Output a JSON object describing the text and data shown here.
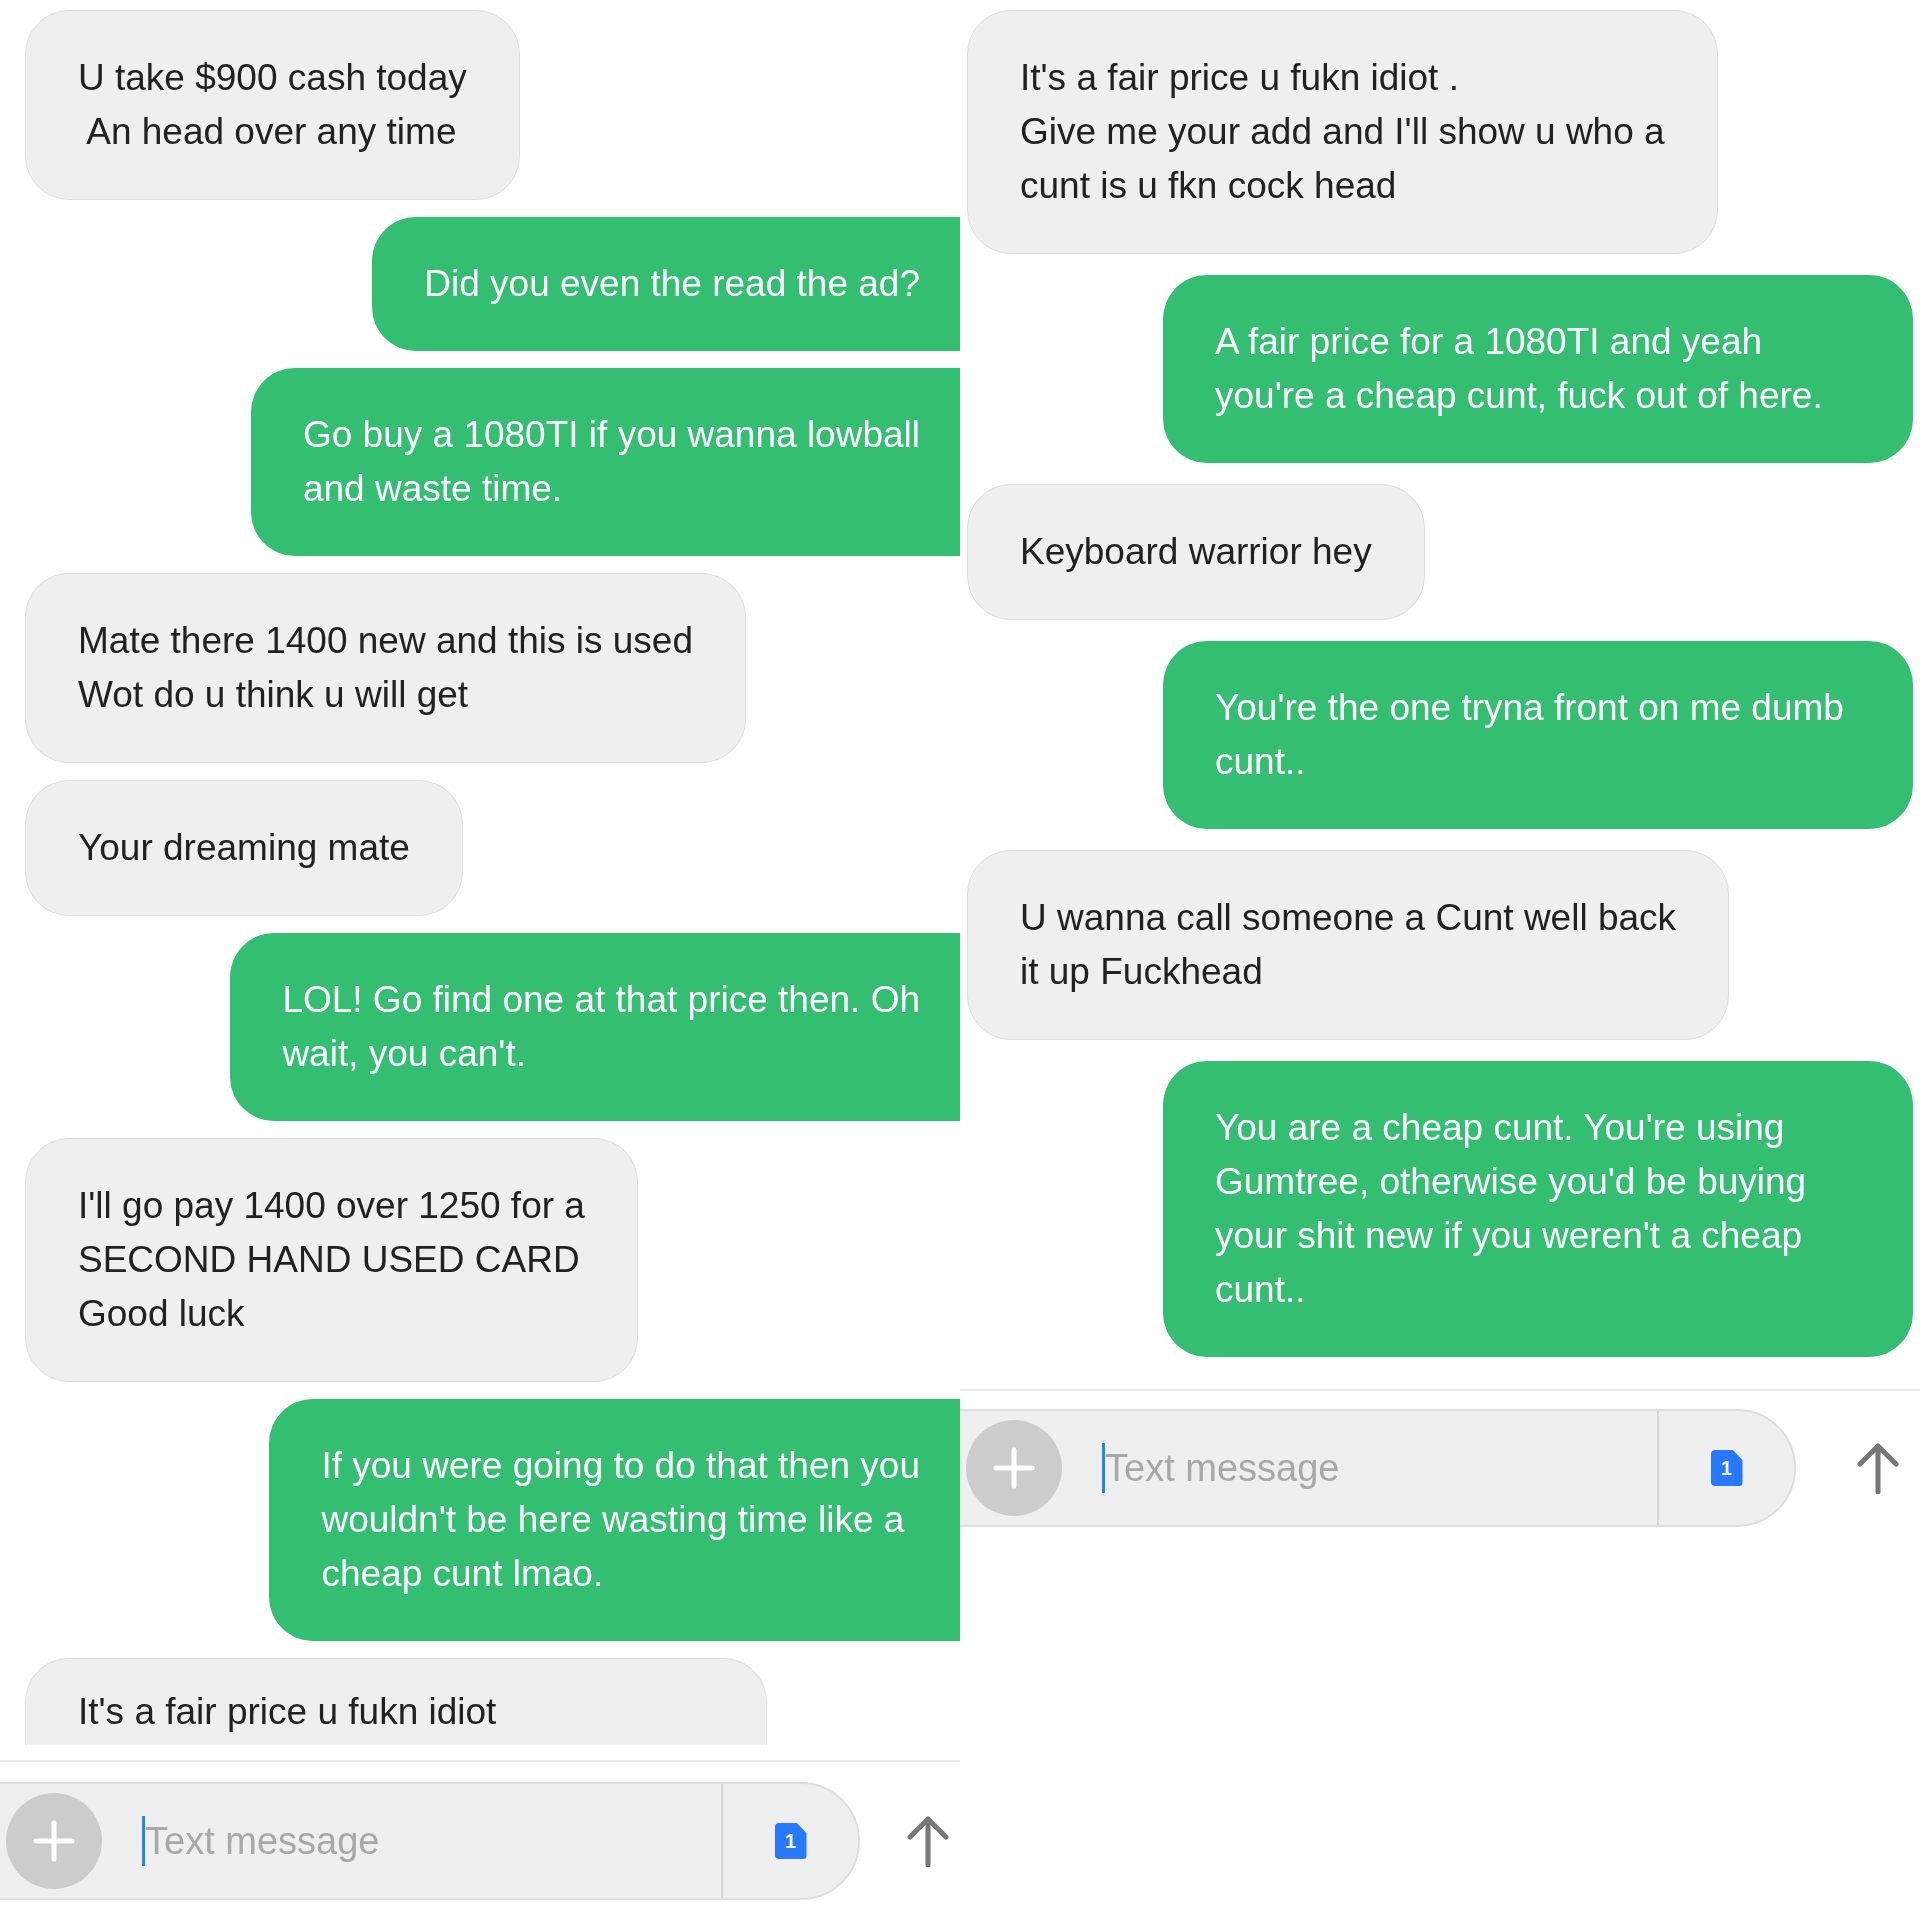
{
  "panels": [
    {
      "messages": [
        {
          "kind": "received",
          "text": "U take $900 cash today\n An head over any time",
          "clipped": false
        },
        {
          "kind": "sent",
          "text": "Did you even the read the ad?",
          "clipped": false
        },
        {
          "kind": "sent",
          "text": "Go buy a 1080TI if you wanna lowball\nand waste time.",
          "clipped": false
        },
        {
          "kind": "received",
          "text": "Mate there 1400 new and this is used\nWot do u think u will get",
          "clipped": false
        },
        {
          "kind": "received",
          "text": "Your dreaming mate",
          "clipped": false
        },
        {
          "kind": "sent",
          "text": "LOL! Go find one at that price then. Oh\nwait, you can't.",
          "clipped": false
        },
        {
          "kind": "received",
          "text": "I'll go pay 1400 over 1250 for a\nSECOND HAND USED CARD\nGood luck",
          "clipped": false
        },
        {
          "kind": "sent",
          "text": "If you were going to do that then you\nwouldn't be here wasting time like a\ncheap cunt lmao.",
          "clipped": false
        },
        {
          "kind": "received",
          "text": "It's a fair price u fukn idiot",
          "clipped": true
        }
      ],
      "composer": {
        "placeholder": "Text message",
        "sim_badge": "1"
      }
    },
    {
      "messages": [
        {
          "kind": "received",
          "text": "It's a fair price u fukn idiot .\nGive me your add and I'll show u who a\ncunt is u fkn cock head",
          "clipped": false
        },
        {
          "kind": "sent",
          "text": "A fair price for a 1080TI and yeah\nyou're a cheap cunt, fuck out of here.",
          "clipped": false
        },
        {
          "kind": "received",
          "text": "Keyboard warrior hey",
          "clipped": false
        },
        {
          "kind": "sent",
          "text": "You're the one tryna front on me dumb\ncunt..",
          "clipped": false
        },
        {
          "kind": "received",
          "text": "U wanna call someone a Cunt well back\nit up Fuckhead",
          "clipped": false
        },
        {
          "kind": "sent",
          "text": "You are a cheap cunt. You're using\nGumtree, otherwise you'd be buying\nyour shit new if you weren't a cheap\ncunt..",
          "clipped": false
        }
      ],
      "composer": {
        "placeholder": "Text message",
        "sim_badge": "1"
      }
    }
  ]
}
